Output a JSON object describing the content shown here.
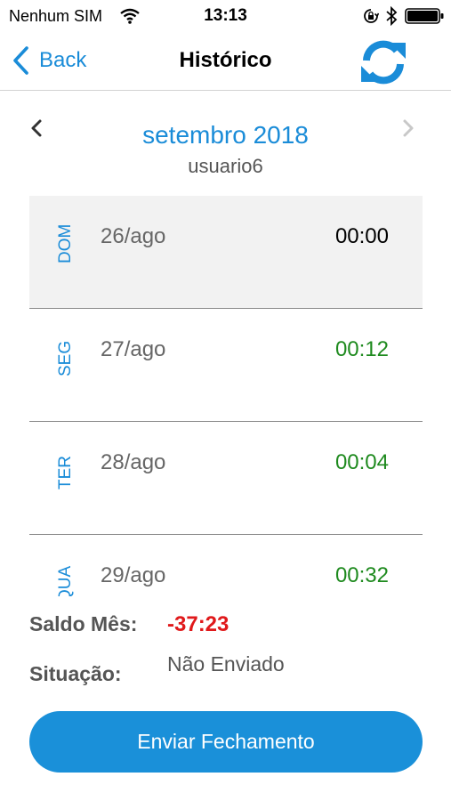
{
  "status_bar": {
    "carrier": "Nenhum SIM",
    "time": "13:13",
    "icons": [
      "wifi-icon",
      "orientation-lock-icon",
      "bluetooth-icon",
      "battery-icon"
    ]
  },
  "nav": {
    "back_label": "Back",
    "title": "Histórico",
    "refresh_icon": "refresh-icon"
  },
  "header": {
    "month": "setembro 2018",
    "user": "usuario6"
  },
  "days": [
    {
      "weekday": "DOM",
      "date": "26/ago",
      "hours": "00:00",
      "hours_color": "#000000",
      "selected": true
    },
    {
      "weekday": "SEG",
      "date": "27/ago",
      "hours": "00:12",
      "hours_color": "#1e8a1e",
      "selected": false
    },
    {
      "weekday": "TER",
      "date": "28/ago",
      "hours": "00:04",
      "hours_color": "#1e8a1e",
      "selected": false
    },
    {
      "weekday": "QUA",
      "date": "29/ago",
      "hours": "00:32",
      "hours_color": "#1e8a1e",
      "selected": false
    }
  ],
  "summary": {
    "saldo_label": "Saldo Mês:",
    "saldo_value": "-37:23",
    "situacao_label": "Situação:",
    "situacao_value": "Não Enviado"
  },
  "send_button_label": "Enviar Fechamento",
  "colors": {
    "accent": "#1a8cd8",
    "negative": "#e0191b",
    "positive": "#1e8a1e",
    "button": "#1a90d9"
  }
}
